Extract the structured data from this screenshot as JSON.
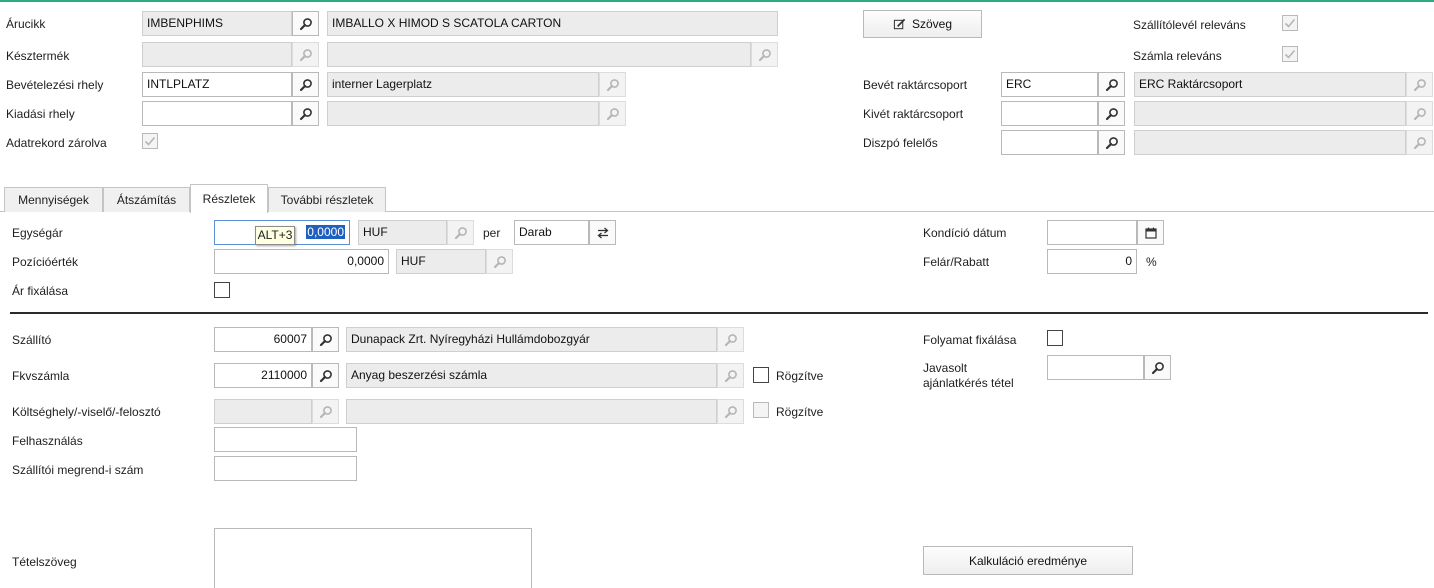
{
  "header": {
    "arucikk": {
      "label": "Árucikk",
      "code": "IMBENPHIMS",
      "desc": "IMBALLO X HIMOD S SCATOLA CARTON"
    },
    "keszt": {
      "label": "Késztermék",
      "code": "",
      "desc": ""
    },
    "bev_hely": {
      "label": "Bevételezési rhely",
      "code": "INTLPLATZ",
      "desc": "interner Lagerplatz"
    },
    "kiad_hely": {
      "label": "Kiadási rhely",
      "code": "",
      "desc": ""
    },
    "locked": {
      "label": "Adatrekord zárolva"
    },
    "text_button": "Szöveg",
    "szallitolevel": {
      "label": "Szállítólevél releváns"
    },
    "szamla": {
      "label": "Számla releváns"
    },
    "bevet_csop": {
      "label": "Bevét raktárcsoport",
      "code": "ERC",
      "desc": "ERC Raktárcsoport"
    },
    "kivet_csop": {
      "label": "Kivét raktárcsoport",
      "code": "",
      "desc": ""
    },
    "dispo": {
      "label": "Diszpó felelős",
      "code": "",
      "desc": ""
    }
  },
  "tabs": [
    "Mennyiségek",
    "Átszámítás",
    "Részletek",
    "További részletek"
  ],
  "active_tab": "Részletek",
  "details": {
    "egysegar": {
      "label": "Egységár",
      "value": "0,0000",
      "currency": "HUF",
      "per": "per",
      "unit": "Darab"
    },
    "tooltip": "ALT+3",
    "pozicio": {
      "label": "Pozícióérték",
      "value": "0,0000",
      "currency": "HUF"
    },
    "ar_fix": {
      "label": "Ár fixálása"
    },
    "kondicio": {
      "label": "Kondíció dátum",
      "value": ""
    },
    "felar": {
      "label": "Felár/Rabatt",
      "value": "0",
      "unit": "%"
    },
    "szallito": {
      "label": "Szállító",
      "code": "60007",
      "desc": "Dunapack Zrt. Nyíregyházi Hullámdobozgyár"
    },
    "fkv": {
      "label": "Fkvszámla",
      "code": "2110000",
      "desc": "Anyag beszerzési számla",
      "rogzitve": "Rögzítve"
    },
    "koltseg": {
      "label": "Költséghely/-viselő/-felosztó",
      "code": "",
      "desc": "",
      "rogzitve": "Rögzítve"
    },
    "felhasznalas": {
      "label": "Felhasználás",
      "value": ""
    },
    "megrend": {
      "label": "Szállítói megrend-i szám",
      "value": ""
    },
    "tetelszoveg": {
      "label": "Tételszöveg",
      "value": ""
    },
    "folyamat": {
      "label": "Folyamat fixálása"
    },
    "javasolt": {
      "label_line1": "Javasolt",
      "label_line2": "ajánlatkérés tétel",
      "value": ""
    },
    "kalkulacio_button": "Kalkuláció eredménye"
  },
  "icons": {
    "lookup": "magnifier-icon",
    "edit": "pencil-icon",
    "calendar": "calendar-icon",
    "swap": "swap-icon",
    "check": "checkmark-icon"
  },
  "colors": {
    "accent": "#2eaa7e",
    "selection": "#1f5fbf",
    "tooltip_bg": "#ffffe1"
  }
}
